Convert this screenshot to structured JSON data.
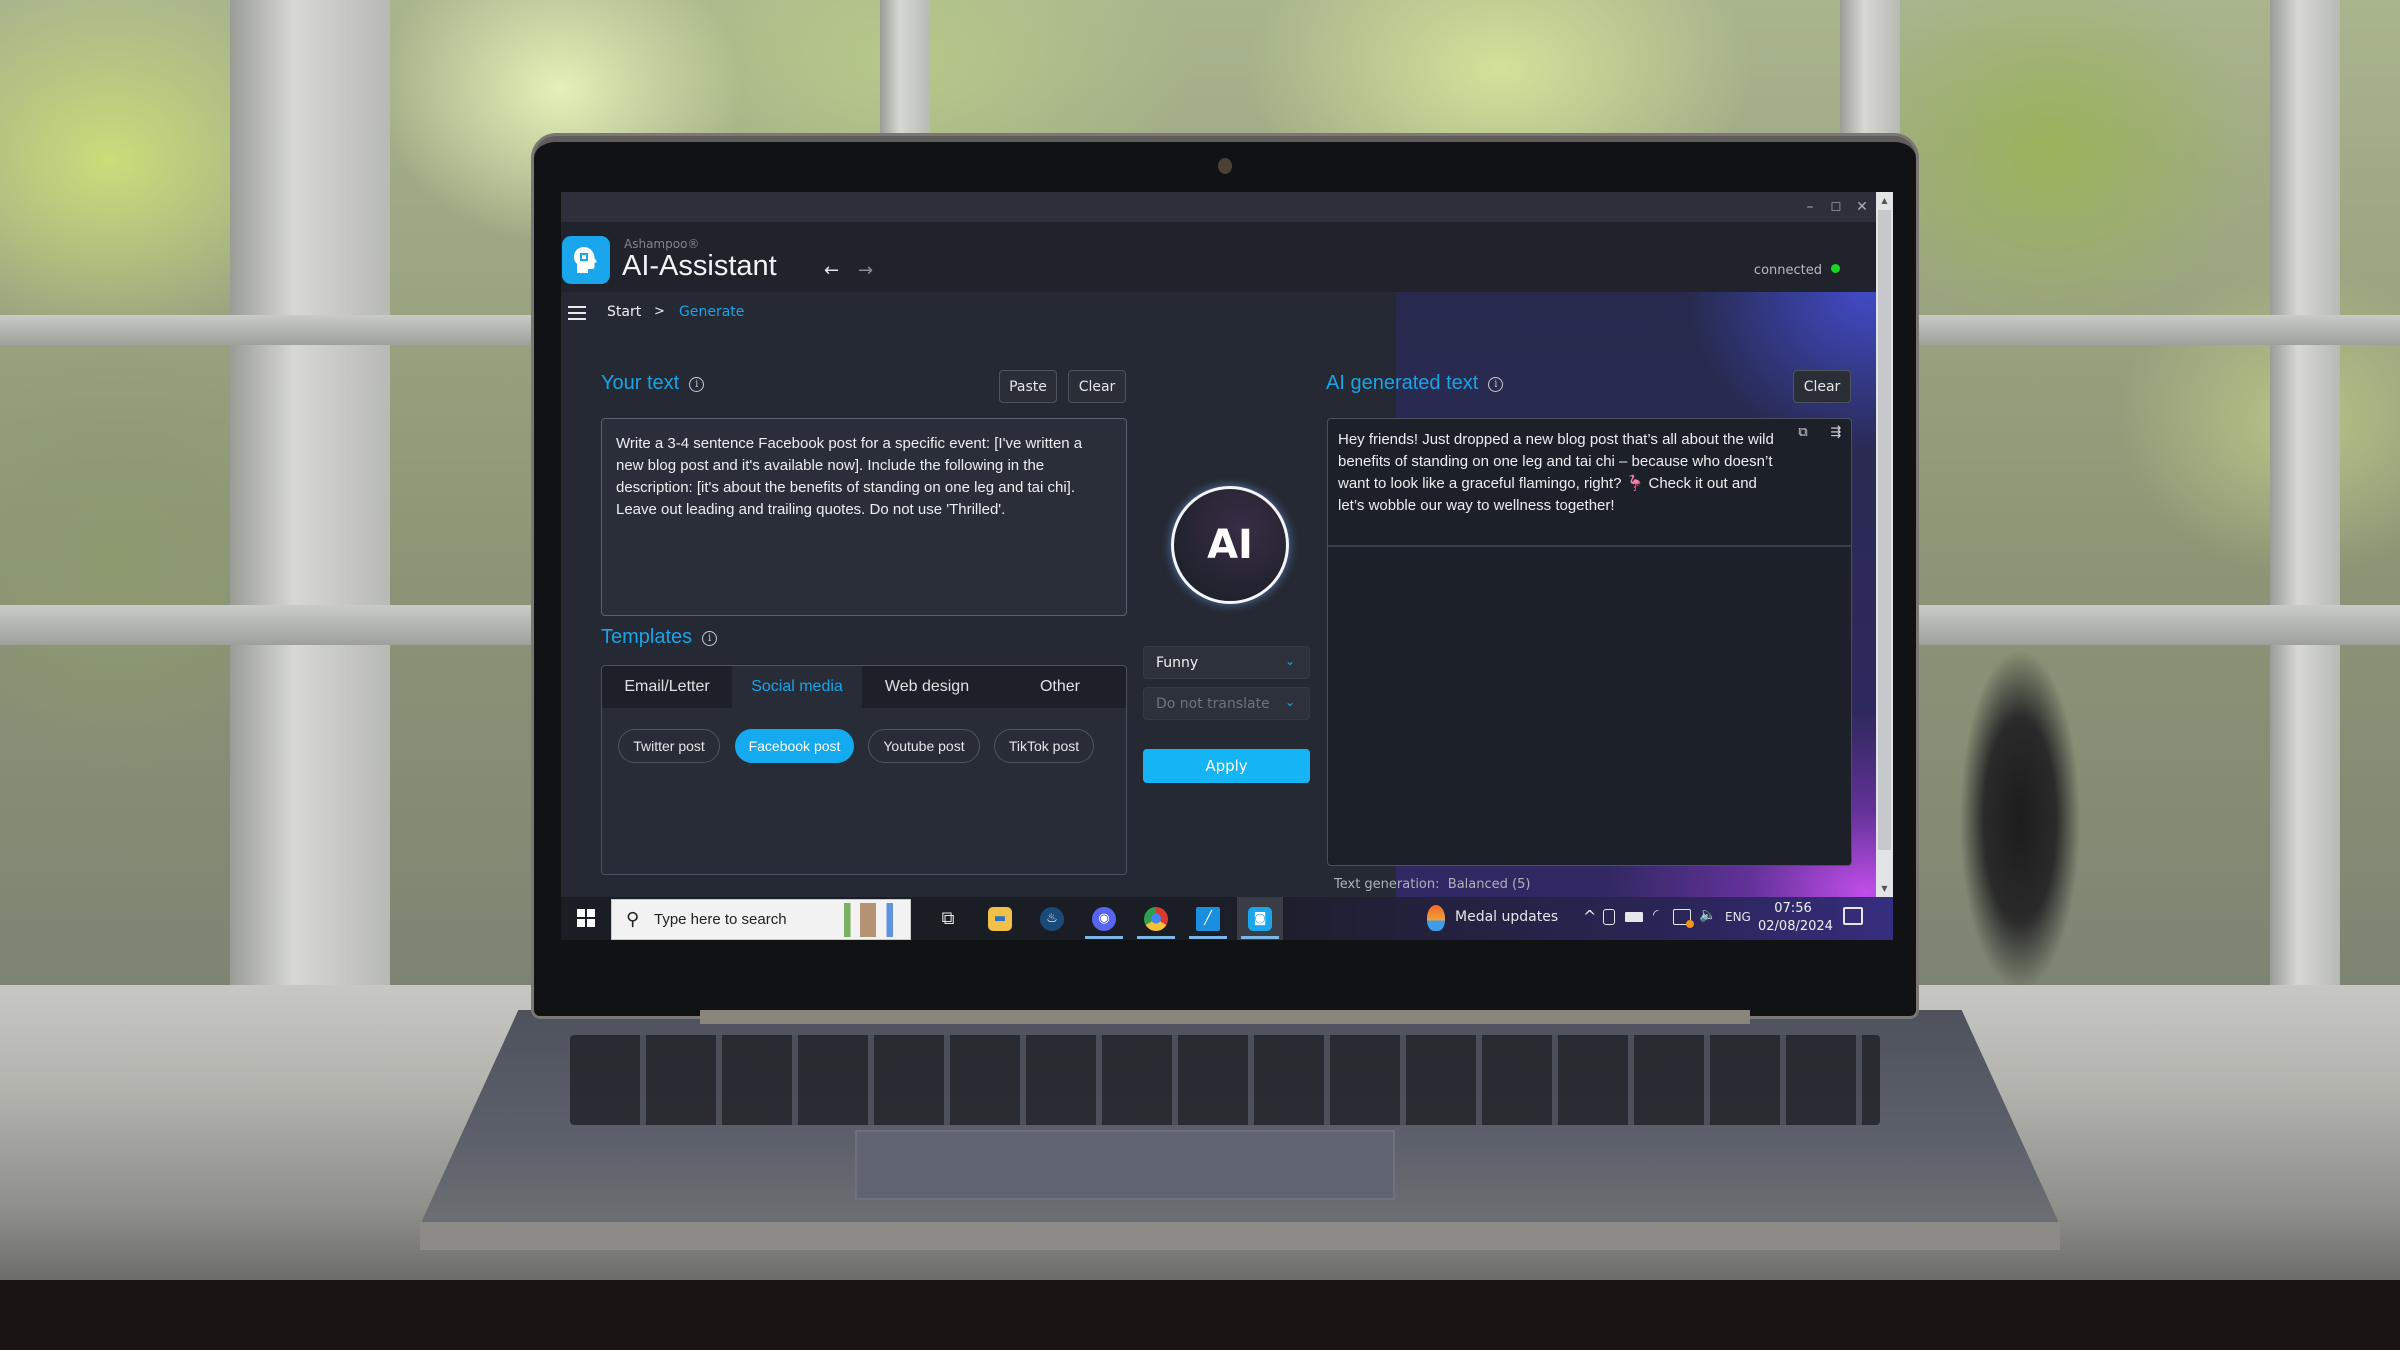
{
  "window": {
    "minimize_glyph": "–",
    "maximize_glyph": "☐",
    "close_glyph": "✕"
  },
  "header": {
    "brand": "Ashampoo®",
    "title": "AI-Assistant",
    "back_glyph": "←",
    "forward_glyph": "→",
    "connection_status": "connected",
    "status_color": "#19d81f"
  },
  "breadcrumb": {
    "items": [
      "Start",
      "Generate"
    ],
    "separator": ">"
  },
  "input_panel": {
    "title": "Your text",
    "info_glyph": "i",
    "paste_label": "Paste",
    "clear_label": "Clear",
    "text": "Write a 3-4 sentence Facebook post for a specific event: [I've written a new blog post and it's available now]. Include the following in the description: [it's about the benefits of standing on one leg and tai chi]. Leave out leading and trailing quotes. Do not use 'Thrilled'."
  },
  "templates": {
    "title": "Templates",
    "tabs": [
      {
        "label": "Email/Letter",
        "active": false
      },
      {
        "label": "Social media",
        "active": true
      },
      {
        "label": "Web design",
        "active": false
      },
      {
        "label": "Other",
        "active": false
      }
    ],
    "items": [
      {
        "label": "Twitter post",
        "selected": false
      },
      {
        "label": "Facebook post",
        "selected": true
      },
      {
        "label": "Youtube post",
        "selected": false
      },
      {
        "label": "TikTok post",
        "selected": false
      }
    ]
  },
  "controls": {
    "ai_badge": "AI",
    "tone": "Funny",
    "translate": "Do not translate",
    "chevron_glyph": "⌄",
    "apply_label": "Apply"
  },
  "output_panel": {
    "title": "AI generated text",
    "clear_label": "Clear",
    "text": "Hey friends! Just dropped a new blog post that’s all about the wild benefits of standing on one leg and tai chi – because who doesn’t want to look like a graceful flamingo, right? 🦩 Check it out and let’s wobble our way to wellness together!",
    "copy_glyph": "⧉",
    "share_glyph": "⇶"
  },
  "status": {
    "label": "Text generation:",
    "value": "Balanced (5)"
  },
  "scrollbar": {
    "up_glyph": "▲",
    "down_glyph": "▼"
  },
  "taskbar": {
    "search_placeholder": "Type here to search",
    "search_glyph": "⚲",
    "apps": [
      {
        "name": "task-view",
        "glyph": "⧉",
        "color": "transparent",
        "open": false,
        "active": false
      },
      {
        "name": "file-explorer",
        "glyph": "▬",
        "color": "#f2c04a",
        "open": false,
        "active": false
      },
      {
        "name": "steam",
        "glyph": "♨",
        "color": "#1a4a7a",
        "open": false,
        "active": false
      },
      {
        "name": "discord",
        "glyph": "◉",
        "color": "#5865f2",
        "open": true,
        "active": false
      },
      {
        "name": "chrome",
        "glyph": "●",
        "color": "#d93a30",
        "open": true,
        "active": false
      },
      {
        "name": "app-blue",
        "glyph": "╱",
        "color": "#1a8fe0",
        "open": true,
        "active": false
      },
      {
        "name": "ai-assistant",
        "glyph": "◙",
        "color": "#19a6ec",
        "open": true,
        "active": true
      }
    ],
    "notification_app": "Medal updates",
    "tray_chevron": "^",
    "language": "ENG",
    "time": "07:56",
    "date": "02/08/2024"
  }
}
